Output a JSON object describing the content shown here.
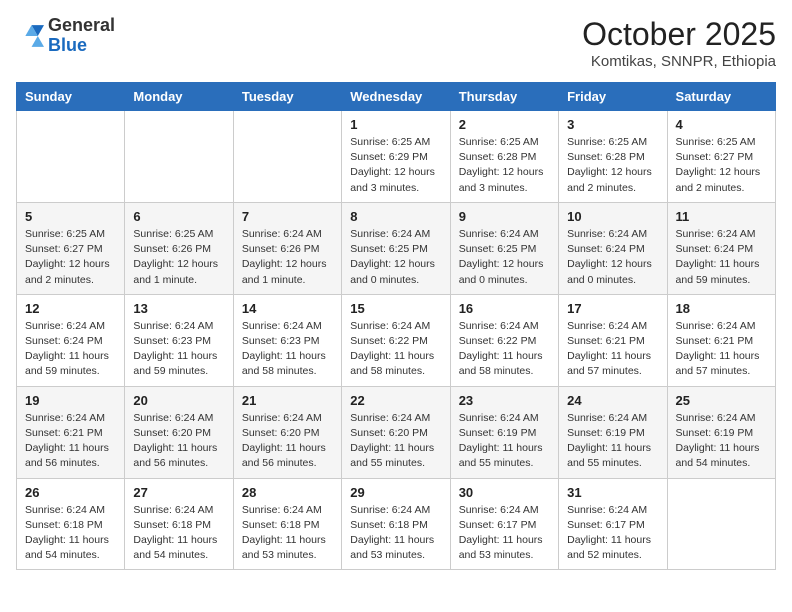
{
  "logo": {
    "general": "General",
    "blue": "Blue"
  },
  "title": "October 2025",
  "location": "Komtikas, SNNPR, Ethiopia",
  "days_of_week": [
    "Sunday",
    "Monday",
    "Tuesday",
    "Wednesday",
    "Thursday",
    "Friday",
    "Saturday"
  ],
  "weeks": [
    [
      {
        "day": "",
        "info": ""
      },
      {
        "day": "",
        "info": ""
      },
      {
        "day": "",
        "info": ""
      },
      {
        "day": "1",
        "info": "Sunrise: 6:25 AM\nSunset: 6:29 PM\nDaylight: 12 hours and 3 minutes."
      },
      {
        "day": "2",
        "info": "Sunrise: 6:25 AM\nSunset: 6:28 PM\nDaylight: 12 hours and 3 minutes."
      },
      {
        "day": "3",
        "info": "Sunrise: 6:25 AM\nSunset: 6:28 PM\nDaylight: 12 hours and 2 minutes."
      },
      {
        "day": "4",
        "info": "Sunrise: 6:25 AM\nSunset: 6:27 PM\nDaylight: 12 hours and 2 minutes."
      }
    ],
    [
      {
        "day": "5",
        "info": "Sunrise: 6:25 AM\nSunset: 6:27 PM\nDaylight: 12 hours and 2 minutes."
      },
      {
        "day": "6",
        "info": "Sunrise: 6:25 AM\nSunset: 6:26 PM\nDaylight: 12 hours and 1 minute."
      },
      {
        "day": "7",
        "info": "Sunrise: 6:24 AM\nSunset: 6:26 PM\nDaylight: 12 hours and 1 minute."
      },
      {
        "day": "8",
        "info": "Sunrise: 6:24 AM\nSunset: 6:25 PM\nDaylight: 12 hours and 0 minutes."
      },
      {
        "day": "9",
        "info": "Sunrise: 6:24 AM\nSunset: 6:25 PM\nDaylight: 12 hours and 0 minutes."
      },
      {
        "day": "10",
        "info": "Sunrise: 6:24 AM\nSunset: 6:24 PM\nDaylight: 12 hours and 0 minutes."
      },
      {
        "day": "11",
        "info": "Sunrise: 6:24 AM\nSunset: 6:24 PM\nDaylight: 11 hours and 59 minutes."
      }
    ],
    [
      {
        "day": "12",
        "info": "Sunrise: 6:24 AM\nSunset: 6:24 PM\nDaylight: 11 hours and 59 minutes."
      },
      {
        "day": "13",
        "info": "Sunrise: 6:24 AM\nSunset: 6:23 PM\nDaylight: 11 hours and 59 minutes."
      },
      {
        "day": "14",
        "info": "Sunrise: 6:24 AM\nSunset: 6:23 PM\nDaylight: 11 hours and 58 minutes."
      },
      {
        "day": "15",
        "info": "Sunrise: 6:24 AM\nSunset: 6:22 PM\nDaylight: 11 hours and 58 minutes."
      },
      {
        "day": "16",
        "info": "Sunrise: 6:24 AM\nSunset: 6:22 PM\nDaylight: 11 hours and 58 minutes."
      },
      {
        "day": "17",
        "info": "Sunrise: 6:24 AM\nSunset: 6:21 PM\nDaylight: 11 hours and 57 minutes."
      },
      {
        "day": "18",
        "info": "Sunrise: 6:24 AM\nSunset: 6:21 PM\nDaylight: 11 hours and 57 minutes."
      }
    ],
    [
      {
        "day": "19",
        "info": "Sunrise: 6:24 AM\nSunset: 6:21 PM\nDaylight: 11 hours and 56 minutes."
      },
      {
        "day": "20",
        "info": "Sunrise: 6:24 AM\nSunset: 6:20 PM\nDaylight: 11 hours and 56 minutes."
      },
      {
        "day": "21",
        "info": "Sunrise: 6:24 AM\nSunset: 6:20 PM\nDaylight: 11 hours and 56 minutes."
      },
      {
        "day": "22",
        "info": "Sunrise: 6:24 AM\nSunset: 6:20 PM\nDaylight: 11 hours and 55 minutes."
      },
      {
        "day": "23",
        "info": "Sunrise: 6:24 AM\nSunset: 6:19 PM\nDaylight: 11 hours and 55 minutes."
      },
      {
        "day": "24",
        "info": "Sunrise: 6:24 AM\nSunset: 6:19 PM\nDaylight: 11 hours and 55 minutes."
      },
      {
        "day": "25",
        "info": "Sunrise: 6:24 AM\nSunset: 6:19 PM\nDaylight: 11 hours and 54 minutes."
      }
    ],
    [
      {
        "day": "26",
        "info": "Sunrise: 6:24 AM\nSunset: 6:18 PM\nDaylight: 11 hours and 54 minutes."
      },
      {
        "day": "27",
        "info": "Sunrise: 6:24 AM\nSunset: 6:18 PM\nDaylight: 11 hours and 54 minutes."
      },
      {
        "day": "28",
        "info": "Sunrise: 6:24 AM\nSunset: 6:18 PM\nDaylight: 11 hours and 53 minutes."
      },
      {
        "day": "29",
        "info": "Sunrise: 6:24 AM\nSunset: 6:18 PM\nDaylight: 11 hours and 53 minutes."
      },
      {
        "day": "30",
        "info": "Sunrise: 6:24 AM\nSunset: 6:17 PM\nDaylight: 11 hours and 53 minutes."
      },
      {
        "day": "31",
        "info": "Sunrise: 6:24 AM\nSunset: 6:17 PM\nDaylight: 11 hours and 52 minutes."
      },
      {
        "day": "",
        "info": ""
      }
    ]
  ]
}
